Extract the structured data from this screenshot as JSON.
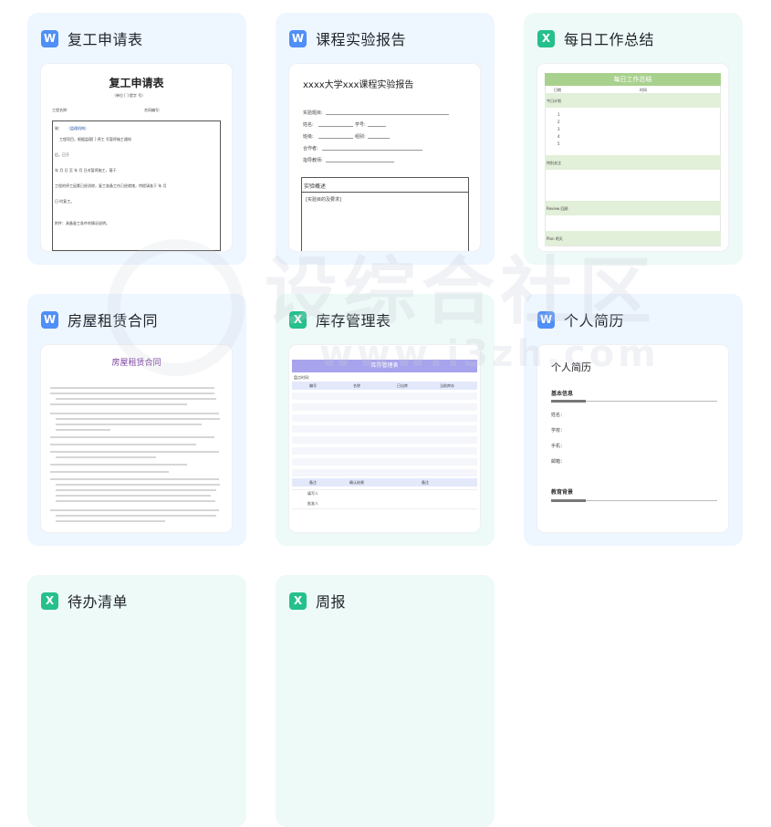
{
  "templates": [
    {
      "title": "复工申请表",
      "type": "W",
      "preview": {
        "heading": "复工申请表",
        "sub": "（单位 [ ] 提字 号）",
        "project": "工程名称:",
        "contract": "合同编号:",
        "to": "致:",
        "to_value": "（监理机构）",
        "l1": "工程项目，根据监理[ ] 停工 号暂停施工通知",
        "l2": "后，已于",
        "l3": "年 月 日 至 年 月 日对暂停施工，基于",
        "l4": "工程的停工因素已经消除，复工准备工作已经就绪，特提请准于 年 月",
        "l5": "日 时复工。",
        "attach": "附件：具备复工条件的情况说明。"
      }
    },
    {
      "title": "课程实验报告",
      "type": "W",
      "preview": {
        "heading": "xxxx大学xxx课程实验报告",
        "f1": "实验题目:",
        "f2": "姓名:",
        "f2b": "学号:",
        "f3": "班级:",
        "f3b": "组别:",
        "f4": "合作者:",
        "f5": "指导教师:",
        "section": "实验概述",
        "section_sub": "[实验目的及要求]"
      }
    },
    {
      "title": "每日工作总结",
      "type": "X",
      "preview": {
        "header": "每日工作总结",
        "c1": "日期",
        "c2": "时间",
        "plan": "今日计划",
        "nums": [
          "1",
          "2",
          "3",
          "4",
          "5"
        ],
        "focus": "特别关注",
        "review": "Review 回顾",
        "plan2": "Plan 明天"
      }
    },
    {
      "title": "房屋租赁合同",
      "type": "W",
      "preview": {
        "heading": "房屋租赁合同"
      }
    },
    {
      "title": "库存管理表",
      "type": "X",
      "preview": {
        "header": "库存管理表",
        "label": "盘点时间:",
        "cols": [
          "编号",
          "名称",
          "已出库",
          "当前库存"
        ],
        "foot1": "备注",
        "foot2": "确认结果",
        "foot3": "备注",
        "s1": "填写人",
        "s2": "批准人"
      }
    },
    {
      "title": "个人简历",
      "type": "W",
      "preview": {
        "heading": "个人简历",
        "section1": "基本信息",
        "fields": [
          "姓名：",
          "学校：",
          "手机：",
          "邮箱："
        ],
        "section2": "教育背景"
      }
    },
    {
      "title": "待办清单",
      "type": "X"
    },
    {
      "title": "周报",
      "type": "X"
    }
  ],
  "watermark": {
    "main": "设综合社区",
    "sub": "www.i3zh.com"
  },
  "colors": {
    "word": "#4f8ff7",
    "excel": "#25c08b",
    "card_blue": "#eef6ff",
    "card_green": "#eefaf7"
  }
}
